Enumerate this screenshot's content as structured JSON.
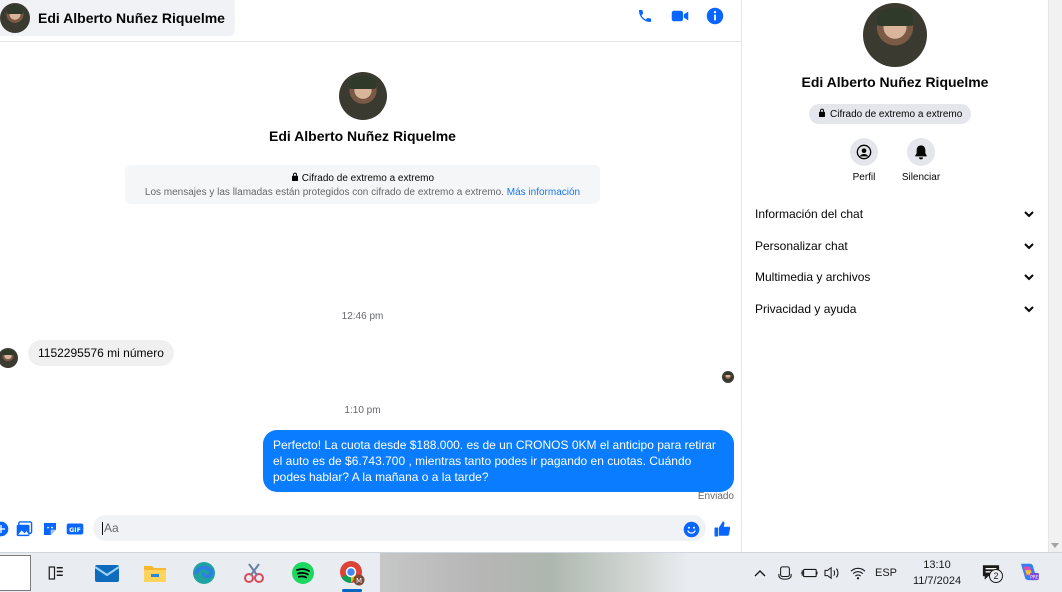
{
  "header": {
    "contact_name": "Edi Alberto Nuñez Riquelme"
  },
  "conversation": {
    "contact_name": "Edi Alberto Nuñez Riquelme",
    "e2e_title": "Cifrado de extremo a extremo",
    "e2e_body": "Los mensajes y las llamadas están protegidos con cifrado de extremo a extremo.",
    "e2e_link": "Más información",
    "messages": [
      {
        "time": "12:46 pm"
      },
      {
        "from": "contact",
        "text": "1152295576 mi número"
      },
      {
        "time": "1:10 pm"
      },
      {
        "from": "me",
        "text": "Perfecto! La cuota desde $188.000. es de un CRONOS 0KM el anticipo para retirar el auto es de $6.743.700 , mientras tanto podes ir pagando en cuotas. Cuándo podes hablar? A la mañana o a la tarde?",
        "status": "Enviado"
      }
    ]
  },
  "composer": {
    "placeholder": "Aa"
  },
  "info_panel": {
    "name": "Edi Alberto Nuñez Riquelme",
    "e2e_badge": "Cifrado de extremo a extremo",
    "actions": [
      "Perfil",
      "Silenciar"
    ],
    "sections": [
      "Información del chat",
      "Personalizar chat",
      "Multimedia y archivos",
      "Privacidad y ayuda"
    ]
  },
  "taskbar": {
    "apps": [
      "task-view",
      "mail",
      "file-explorer",
      "edge",
      "snipping-tool",
      "spotify",
      "chrome"
    ],
    "language": "ESP",
    "time": "13:10",
    "date": "11/7/2024",
    "notification_count": "2"
  },
  "colors": {
    "accent": "#0a7cff",
    "messenger_blue": "#0866ff"
  }
}
